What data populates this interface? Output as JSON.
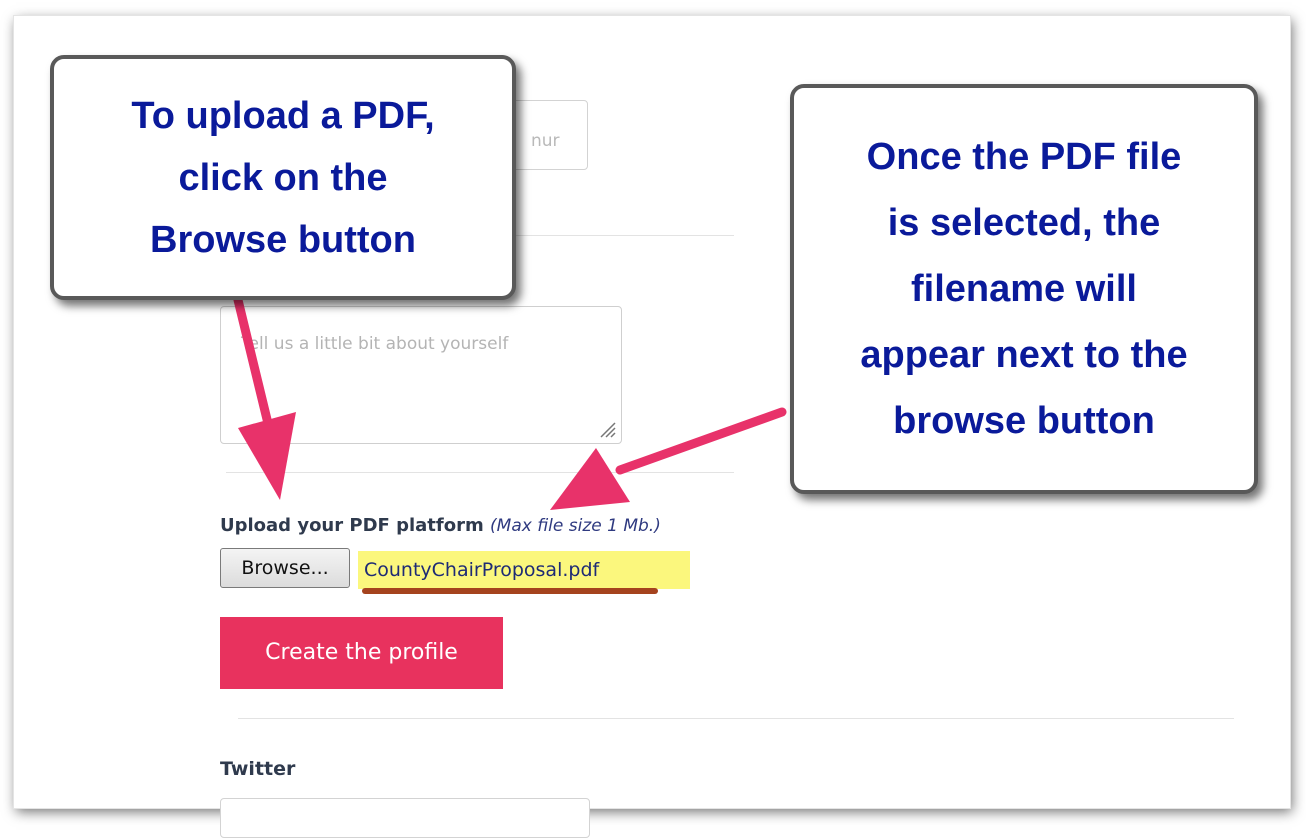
{
  "form": {
    "phone_placeholder": "nur",
    "bio_placeholder": "Tell us a little bit about yourself",
    "upload": {
      "label": "Upload your PDF platform",
      "hint": "(Max file size 1 Mb.)",
      "browse_label": "Browse...",
      "selected_filename": "CountyChairProposal.pdf"
    },
    "create_button_label": "Create the profile",
    "twitter_label": "Twitter"
  },
  "annotations": {
    "left_callout": "To upload a PDF,\nclick on the\nBrowse button",
    "right_callout": "Once the PDF file\nis selected, the\nfilename will\nappear next to the\nbrowse button",
    "arrow_color": "#e8326a",
    "text_color": "#0a1a9a",
    "highlight_color": "#fbf77d"
  }
}
